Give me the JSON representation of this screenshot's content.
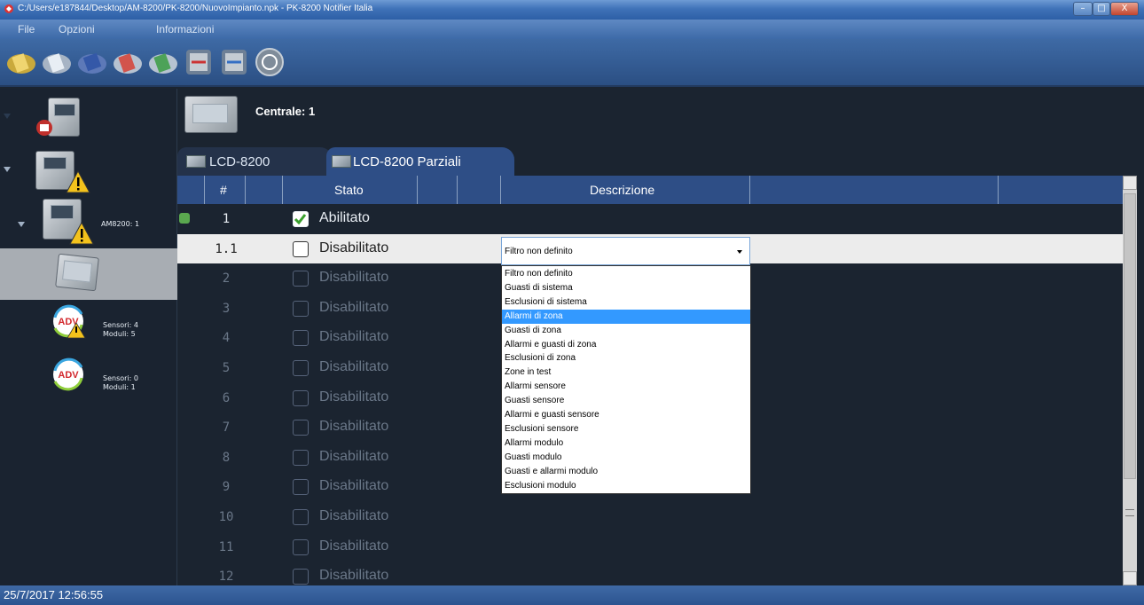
{
  "window": {
    "title": "C:/Users/e187844/Desktop/AM-8200/PK-8200/NuovoImpianto.npk - PK-8200 Notifier Italia",
    "minimize_label": "–",
    "maximize_label": "□",
    "close_label": "X"
  },
  "menu": {
    "items": [
      "File",
      "Opzioni",
      "Informazioni"
    ]
  },
  "toolbar": {
    "icons": [
      "new-file-icon",
      "open-file-icon",
      "save-disk-icon",
      "remove-icon",
      "add-icon",
      "download-icon",
      "upload-icon",
      "sync-icon"
    ]
  },
  "tree": {
    "nodes": [
      {
        "icon": "building-panel-icon",
        "label": ""
      },
      {
        "icon": "panel-warning-icon",
        "label": ""
      },
      {
        "icon": "am8200-panel-icon",
        "label": "AM8200: 1"
      },
      {
        "icon": "lcd-panel-icon",
        "label": ""
      },
      {
        "icon": "adv-loop-warning-icon",
        "sensors": "Sensori: 4",
        "modules": "Moduli: 5"
      },
      {
        "icon": "adv-loop-icon",
        "sensors": "Sensori: 0",
        "modules": "Moduli: 1"
      }
    ]
  },
  "header": {
    "title": "Centrale: 1"
  },
  "tabs": [
    {
      "label": "LCD-8200",
      "active": false
    },
    {
      "label": "LCD-8200 Parziali",
      "active": true
    }
  ],
  "grid": {
    "columns": [
      "#",
      "Stato",
      "Descrizione"
    ],
    "rows": [
      {
        "num": "1",
        "state": "Abilitato",
        "checked": true,
        "enabled": true
      },
      {
        "num": "1.1",
        "state": "Disabilitato",
        "checked": false,
        "enabled": true
      },
      {
        "num": "2",
        "state": "Disabilitato",
        "checked": false,
        "enabled": false
      },
      {
        "num": "3",
        "state": "Disabilitato",
        "checked": false,
        "enabled": false
      },
      {
        "num": "4",
        "state": "Disabilitato",
        "checked": false,
        "enabled": false
      },
      {
        "num": "5",
        "state": "Disabilitato",
        "checked": false,
        "enabled": false
      },
      {
        "num": "6",
        "state": "Disabilitato",
        "checked": false,
        "enabled": false
      },
      {
        "num": "7",
        "state": "Disabilitato",
        "checked": false,
        "enabled": false
      },
      {
        "num": "8",
        "state": "Disabilitato",
        "checked": false,
        "enabled": false
      },
      {
        "num": "9",
        "state": "Disabilitato",
        "checked": false,
        "enabled": false
      },
      {
        "num": "10",
        "state": "Disabilitato",
        "checked": false,
        "enabled": false
      },
      {
        "num": "11",
        "state": "Disabilitato",
        "checked": false,
        "enabled": false
      },
      {
        "num": "12",
        "state": "Disabilitato",
        "checked": false,
        "enabled": false
      }
    ]
  },
  "combo": {
    "value": "Filtro non definito",
    "options": [
      "Filtro non definito",
      "Guasti di sistema",
      "Esclusioni di sistema",
      "Allarmi di zona",
      "Guasti di zona",
      "Allarmi e guasti di zona",
      "Esclusioni di zona",
      "Zone in test",
      "Allarmi sensore",
      "Guasti sensore",
      "Allarmi e guasti sensore",
      "Esclusioni sensore",
      "Allarmi modulo",
      "Guasti modulo",
      "Guasti e allarmi modulo",
      "Esclusioni modulo"
    ],
    "highlighted_index": 3
  },
  "status": {
    "datetime": "25/7/2017  12:56:55"
  },
  "colors": {
    "accent": "#2e4e86",
    "selection": "#3399ff",
    "background": "#1b2430"
  }
}
